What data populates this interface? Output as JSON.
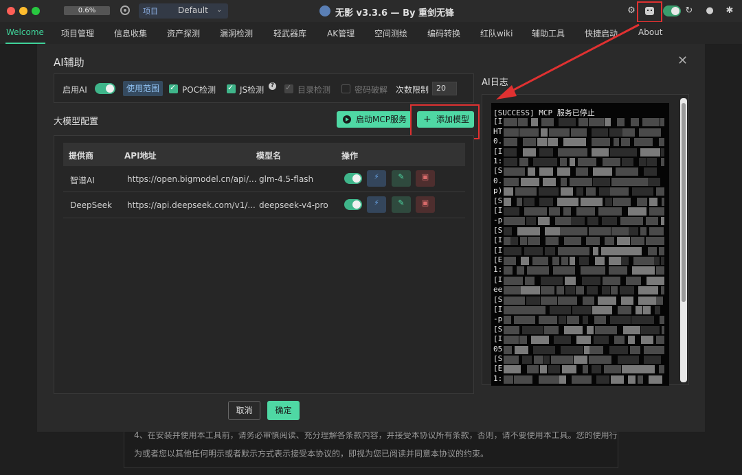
{
  "titlebar": {
    "progress": "0.6%",
    "project_tag": "项目",
    "project_value": "Default",
    "app_title": "无影 v3.3.6 — By 重剑无锋"
  },
  "menu": {
    "items": [
      "Welcome",
      "项目管理",
      "信息收集",
      "资产探测",
      "漏洞检测",
      "轻武器库",
      "AK管理",
      "空间测绘",
      "编码转换",
      "红队wiki",
      "辅助工具",
      "快捷启动",
      "About"
    ],
    "active": "Welcome"
  },
  "background_text": {
    "line1": "4、在安装并使用本工具前，请务必审慎阅读、充分理解各条款内容，并接受本协议所有条款，否则，请不要使用本工具。您的使用行",
    "line2": "为或者您以其他任何明示或者默示方式表示接受本协议的，即视为您已阅读并同意本协议的约束。"
  },
  "modal": {
    "title": "AI辅助",
    "settings": {
      "enable_ai_label": "启用AI",
      "scope_button": "使用范围",
      "poc_label": "POC检测",
      "js_label": "JS检测",
      "help_mark": "?",
      "dir_label": "目录检测",
      "pwd_label": "密码破解",
      "limit_label": "次数限制",
      "limit_value": "20"
    },
    "model_section_title": "大模型配置",
    "mcp_button": "启动MCP服务",
    "add_button": "添加模型",
    "table": {
      "headers": [
        "提供商",
        "API地址",
        "模型名",
        "操作"
      ],
      "rows": [
        {
          "provider": "智谱AI",
          "api": "https://open.bigmodel.cn/api/...",
          "model": "glm-4.5-flash"
        },
        {
          "provider": "DeepSeek",
          "api": "https://api.deepseek.com/v1/...",
          "model": "deepseek-v4-pro"
        }
      ]
    },
    "cancel_button": "取消",
    "ok_button": "确定",
    "log_title": "AI日志",
    "log_lines": [
      "[SUCCESS] MCP 服务已停止",
      "[I",
      "HT",
      "0.",
      "[I",
      "1:",
      "[S",
      "0.",
      "p)",
      "[S",
      "[I",
      "-p",
      "[S",
      "[I",
      "[I",
      "[E",
      "1:",
      "[I",
      "ee",
      "[S",
      "[I",
      "-p",
      "[S",
      "[I",
      "05",
      "[S",
      "[E",
      "1:"
    ]
  },
  "colors": {
    "accent": "#4fd8a4",
    "highlight_box": "#e03131",
    "background": "#1f1f1f"
  }
}
